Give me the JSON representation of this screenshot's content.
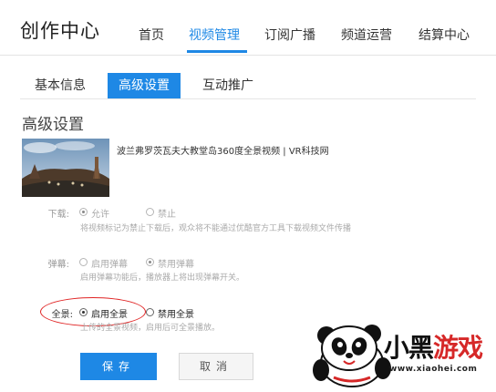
{
  "header": {
    "brand": "创作中心",
    "nav": [
      "首页",
      "视频管理",
      "订阅广播",
      "频道运营",
      "结算中心"
    ],
    "active_nav": "视频管理"
  },
  "subtabs": [
    "基本信息",
    "高级设置",
    "互动推广"
  ],
  "active_subtab": "高级设置",
  "section_title": "高级设置",
  "video": {
    "title": "波兰弗罗茨瓦夫大教堂岛360度全景视频 | VR科技网"
  },
  "download": {
    "label": "下载:",
    "options": [
      "允许",
      "禁止"
    ],
    "selected": "允许",
    "hint": "将视频标记为禁止下载后，观众将不能通过优酷官方工具下载视频文件传播"
  },
  "danmaku": {
    "label": "弹幕:",
    "options": [
      "启用弹幕",
      "禁用弹幕"
    ],
    "selected": "禁用弹幕",
    "hint": "启用弹幕功能后，播放器上将出现弹幕开关。"
  },
  "panorama": {
    "label": "全景:",
    "options": [
      "启用全景",
      "禁用全景"
    ],
    "selected": "启用全景",
    "hint": "上传的全景视频，启用后可全景播放。"
  },
  "buttons": {
    "save": "保存",
    "cancel": "取消"
  },
  "watermark": {
    "text_black": "小黑",
    "text_red": "游戏",
    "url": "www.xiaohei.com"
  },
  "colors": {
    "accent": "#1e88e5",
    "highlight": "#e02424"
  }
}
